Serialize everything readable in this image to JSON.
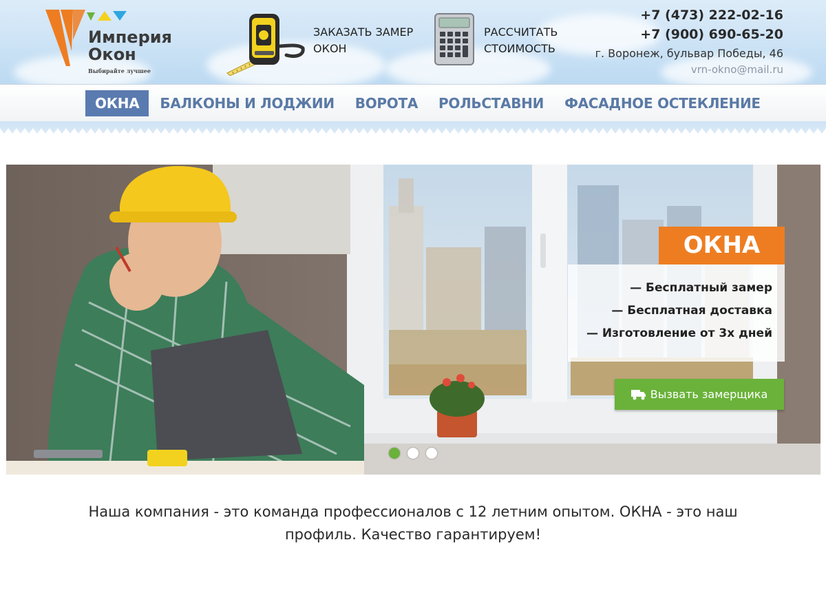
{
  "brand": {
    "name_line1": "Империя",
    "name_line2": "Окон",
    "tagline": "Выбирайте лучшее",
    "colors": {
      "orange": "#EE7D22",
      "green": "#6AB23A",
      "blue": "#5A7BB0",
      "yellow": "#F5D21E",
      "light_blue": "#2EA6E0"
    }
  },
  "header": {
    "order_measure": {
      "line1": "ЗАКАЗАТЬ ЗАМЕР",
      "line2": "ОКОН",
      "icon": "tape-measure-icon"
    },
    "calculate": {
      "line1": "РАССЧИТАТЬ",
      "line2": "СТОИМОСТЬ",
      "icon": "calculator-icon"
    },
    "contacts": {
      "phone1": "+7 (473) 222-02-16",
      "phone2": "+7 (900) 690-65-20",
      "address": "г. Воронеж, бульвар Победы, 46",
      "email": "vrn-okno@mail.ru"
    }
  },
  "nav": {
    "items": [
      {
        "label": "ОКНА",
        "active": true
      },
      {
        "label": "БАЛКОНЫ И ЛОДЖИИ",
        "active": false
      },
      {
        "label": "ВОРОТА",
        "active": false
      },
      {
        "label": "РОЛЬСТАВНИ",
        "active": false
      },
      {
        "label": "ФАСАДНОЕ ОСТЕКЛЕНИЕ",
        "active": false
      }
    ]
  },
  "hero": {
    "title": "ОКНА",
    "features": [
      "— Бесплатный замер",
      "— Бесплатная доставка",
      "— Изготовление от 3х дней"
    ],
    "cta_label": "Вызвать замерщика",
    "cta_icon": "truck-icon",
    "slides_total": 3,
    "active_slide": 1
  },
  "intro": {
    "line1": "Наша компания - это команда профессионалов с 12 летним опытом. ОКНА - это наш",
    "line2": "профиль. Качество гарантируем!"
  }
}
